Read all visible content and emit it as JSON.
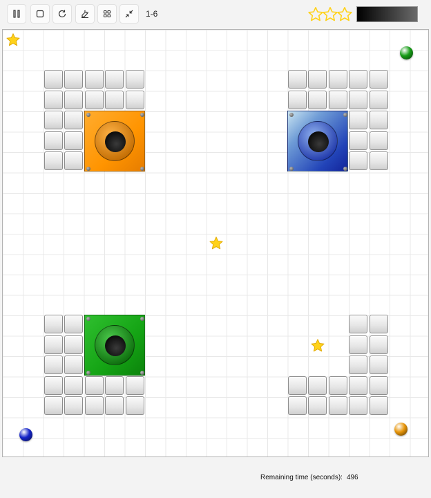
{
  "toolbar": {
    "buttons": [
      {
        "name": "pause-button",
        "icon": "pause-icon"
      },
      {
        "name": "stop-button",
        "icon": "stop-icon"
      },
      {
        "name": "restart-button",
        "icon": "refresh-icon"
      },
      {
        "name": "edit-button",
        "icon": "eraser-edit-icon"
      },
      {
        "name": "levels-button",
        "icon": "grid-icon"
      },
      {
        "name": "collapse-button",
        "icon": "collapse-icon"
      }
    ],
    "level": "1-6"
  },
  "rating": {
    "stars_total": 3,
    "stars_earned": 0
  },
  "progress": {
    "fraction": 1.0
  },
  "board": {
    "holes": [
      {
        "color": "orange"
      },
      {
        "color": "blue"
      },
      {
        "color": "green"
      }
    ],
    "balls": [
      {
        "color": "green",
        "hex": "#169c16"
      },
      {
        "color": "blue",
        "hex": "#1424c9"
      },
      {
        "color": "orange",
        "hex": "#e8960a"
      }
    ],
    "stars_collectible": 3,
    "colors": {
      "star": "#ffd21a",
      "star_stroke": "#e0a800"
    }
  },
  "status": {
    "label": "Remaining time (seconds):",
    "value": "496"
  }
}
